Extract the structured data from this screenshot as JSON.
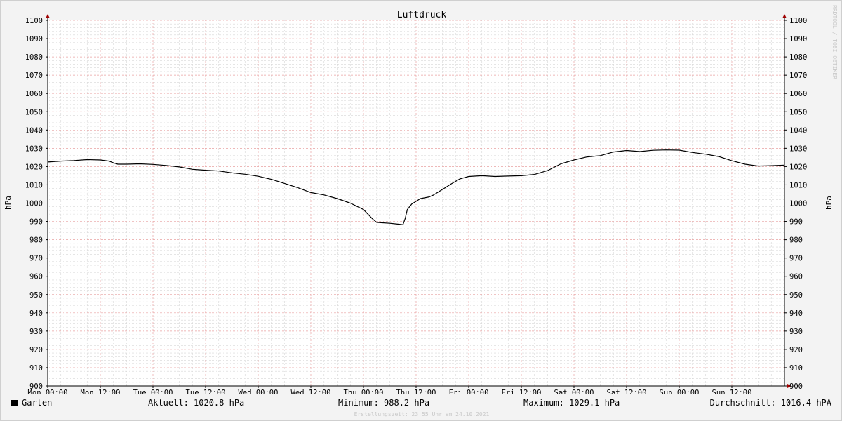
{
  "chart_data": {
    "type": "line",
    "title": "Luftdruck",
    "ylabel_left": "hPa",
    "ylabel_right": "hPa",
    "ylim": [
      900,
      1100
    ],
    "yticks": [
      900,
      910,
      920,
      930,
      940,
      950,
      960,
      970,
      980,
      990,
      1000,
      1010,
      1020,
      1030,
      1040,
      1050,
      1060,
      1070,
      1080,
      1090,
      1100
    ],
    "xlim_hours": [
      0,
      168
    ],
    "xtick_labels": [
      "Mon 00:00",
      "Mon 12:00",
      "Tue 00:00",
      "Tue 12:00",
      "Wed 00:00",
      "Wed 12:00",
      "Thu 00:00",
      "Thu 12:00",
      "Fri 00:00",
      "Fri 12:00",
      "Sat 00:00",
      "Sat 12:00",
      "Sun 00:00",
      "Sun 12:00"
    ],
    "grid": true,
    "series": [
      {
        "name": "Garten",
        "color": "#000000",
        "x_hours": [
          0,
          3,
          6,
          9,
          12,
          14,
          15,
          16,
          18,
          21,
          24,
          27,
          30,
          33,
          36,
          39,
          42,
          45,
          48,
          51,
          54,
          57,
          60,
          63,
          66,
          69,
          72,
          74,
          75,
          76,
          78,
          80,
          81,
          81.5,
          82,
          83,
          85,
          87,
          88,
          90,
          92,
          94,
          96,
          99,
          102,
          105,
          108,
          111,
          114,
          117,
          120,
          123,
          126,
          129,
          132,
          135,
          138,
          141,
          144,
          147,
          150,
          153,
          156,
          159,
          162,
          165,
          168
        ],
        "y_hpa": [
          1022.5,
          1023,
          1023.3,
          1023.8,
          1023.6,
          1023,
          1022,
          1021.3,
          1021.3,
          1021.5,
          1021.2,
          1020.6,
          1019.8,
          1018.5,
          1018,
          1017.6,
          1016.6,
          1015.8,
          1014.7,
          1013,
          1010.8,
          1008.5,
          1005.8,
          1004.5,
          1002.5,
          1000,
          996.5,
          991.5,
          989.5,
          989.3,
          989,
          988.5,
          988.2,
          991.5,
          996.5,
          999.5,
          1002.5,
          1003.4,
          1004.5,
          1007.5,
          1010.5,
          1013.3,
          1014.6,
          1015,
          1014.6,
          1014.8,
          1015,
          1015.7,
          1017.8,
          1021.5,
          1023.6,
          1025.3,
          1026,
          1028,
          1028.8,
          1028.2,
          1028.9,
          1029.1,
          1029,
          1027.7,
          1026.8,
          1025.5,
          1023.2,
          1021.3,
          1020.3,
          1020.5,
          1020.8
        ]
      }
    ]
  },
  "legend": {
    "series_name": "Garten",
    "current": "Aktuell: 1020.8 hPa",
    "minimum": "Minimum: 988.2 hPa",
    "maximum": "Maximum: 1029.1 hPa",
    "average": "Durchschnitt: 1016.4 hPA"
  },
  "footer": "Erstellungszeit: 23:55 Uhr am 24.10.2021",
  "watermark": "RRDTOOL / TOBI OETIKER"
}
